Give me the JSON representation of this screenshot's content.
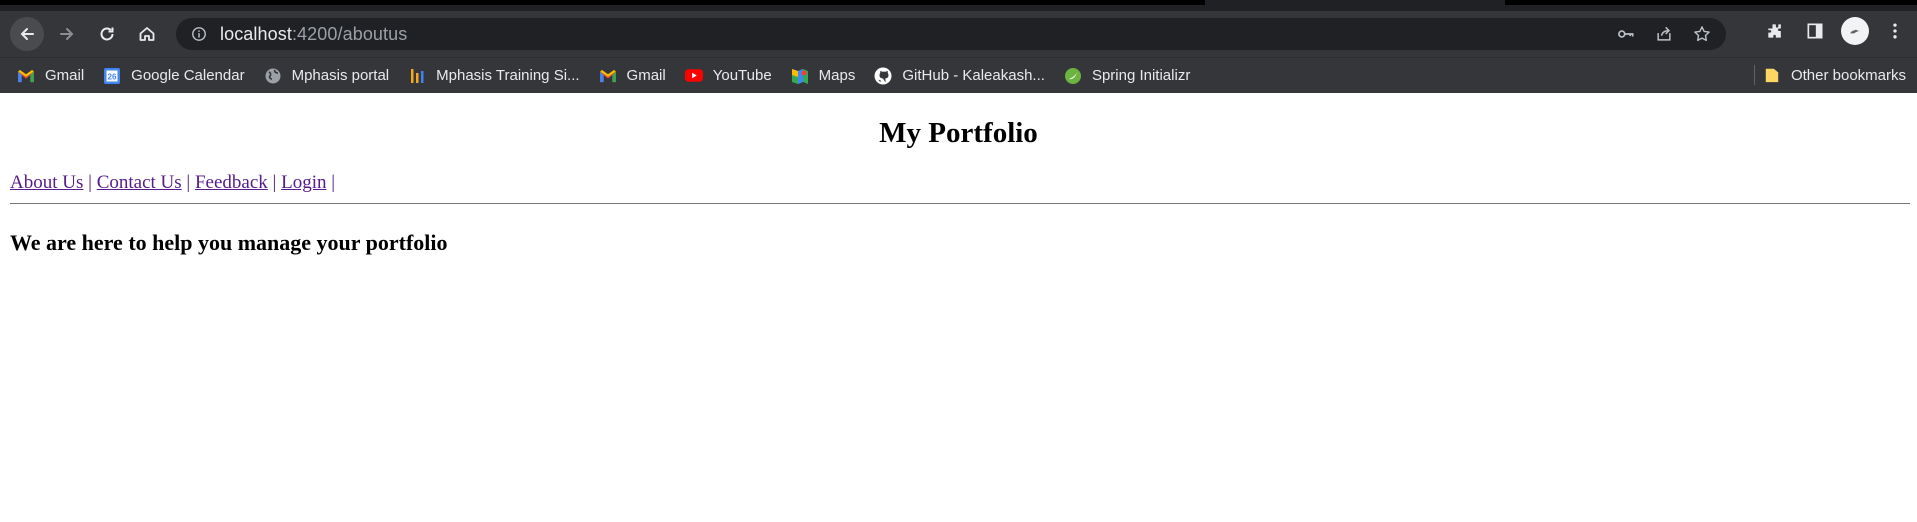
{
  "browser": {
    "url_host": "localhost",
    "url_path": ":4200/aboutus",
    "icons": {
      "back": "arrow-left-icon",
      "forward": "arrow-right-icon",
      "reload": "reload-icon",
      "home": "home-icon",
      "site_info": "info-icon",
      "password_key": "key-icon",
      "share": "share-icon",
      "bookmark_star": "star-icon",
      "extensions": "puzzle-icon",
      "side_panel": "side-panel-icon",
      "menu": "kebab-menu-icon"
    }
  },
  "bookmarks": [
    {
      "label": "Gmail",
      "icon": "gmail-icon"
    },
    {
      "label": "Google Calendar",
      "icon": "calendar-icon"
    },
    {
      "label": "Mphasis portal",
      "icon": "globe-icon"
    },
    {
      "label": "Mphasis Training Si...",
      "icon": "bars-icon"
    },
    {
      "label": "Gmail",
      "icon": "gmail-icon"
    },
    {
      "label": "YouTube",
      "icon": "youtube-icon"
    },
    {
      "label": "Maps",
      "icon": "maps-icon"
    },
    {
      "label": "GitHub - Kaleakash...",
      "icon": "github-icon"
    },
    {
      "label": "Spring Initializr",
      "icon": "spring-icon"
    }
  ],
  "other_bookmarks": "Other bookmarks",
  "page": {
    "title": "My Portfolio",
    "nav": [
      "About Us",
      "Contact Us",
      "Feedback",
      "Login"
    ],
    "separator": "|",
    "tagline": "We are here to help you manage your portfolio"
  }
}
